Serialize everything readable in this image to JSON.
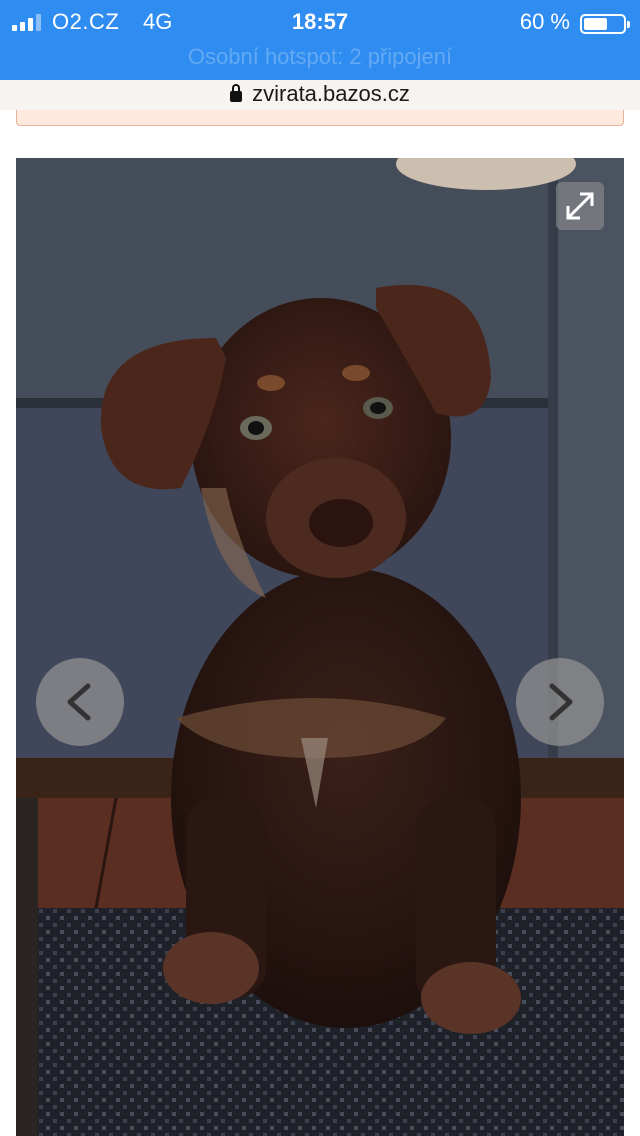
{
  "status_bar": {
    "carrier": "O2.CZ",
    "network": "4G",
    "time": "18:57",
    "battery_percent_label": "60 %",
    "battery_level": 0.6,
    "hotspot_text": "Osobní hotspot: 2 připojení",
    "color": "#2f8cf0"
  },
  "browser": {
    "url": "zvirata.bazos.cz",
    "lock_icon": "lock-icon"
  },
  "gallery": {
    "image_subject": "puppy-photo",
    "expand_icon": "expand-icon",
    "prev_icon": "chevron-left-icon",
    "next_icon": "chevron-right-icon"
  }
}
